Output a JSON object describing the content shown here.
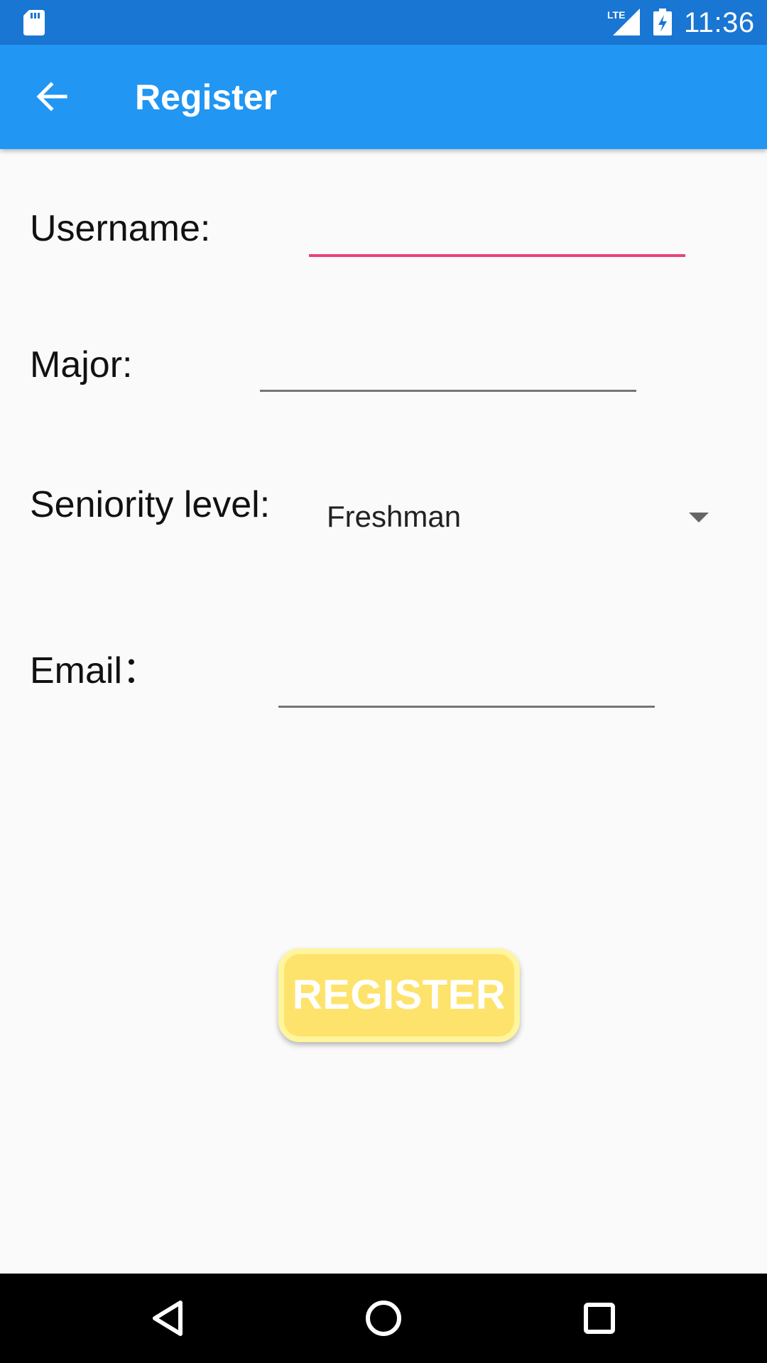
{
  "status_bar": {
    "time": "11:36",
    "network": "LTE",
    "icons": [
      "sd-card-icon",
      "lte-signal-icon",
      "battery-charging-icon"
    ]
  },
  "app_bar": {
    "title": "Register",
    "back_icon": "arrow-back-icon"
  },
  "form": {
    "username": {
      "label": "Username:",
      "value": "",
      "placeholder": ""
    },
    "major": {
      "label": "Major:",
      "value": "",
      "placeholder": ""
    },
    "seniority": {
      "label": "Seniority level:",
      "selected": "Freshman"
    },
    "email": {
      "label": "Email：",
      "value": "",
      "placeholder": ""
    }
  },
  "register_button": {
    "label": "REGISTER"
  },
  "nav_bar": {
    "icons": [
      "nav-back-icon",
      "nav-home-icon",
      "nav-recents-icon"
    ]
  },
  "colors": {
    "status_bar": "#1976d2",
    "app_bar": "#2196f3",
    "focus_accent": "#e84377",
    "button": "#fde36b",
    "button_border": "#fff59d",
    "background": "#fafafa"
  }
}
